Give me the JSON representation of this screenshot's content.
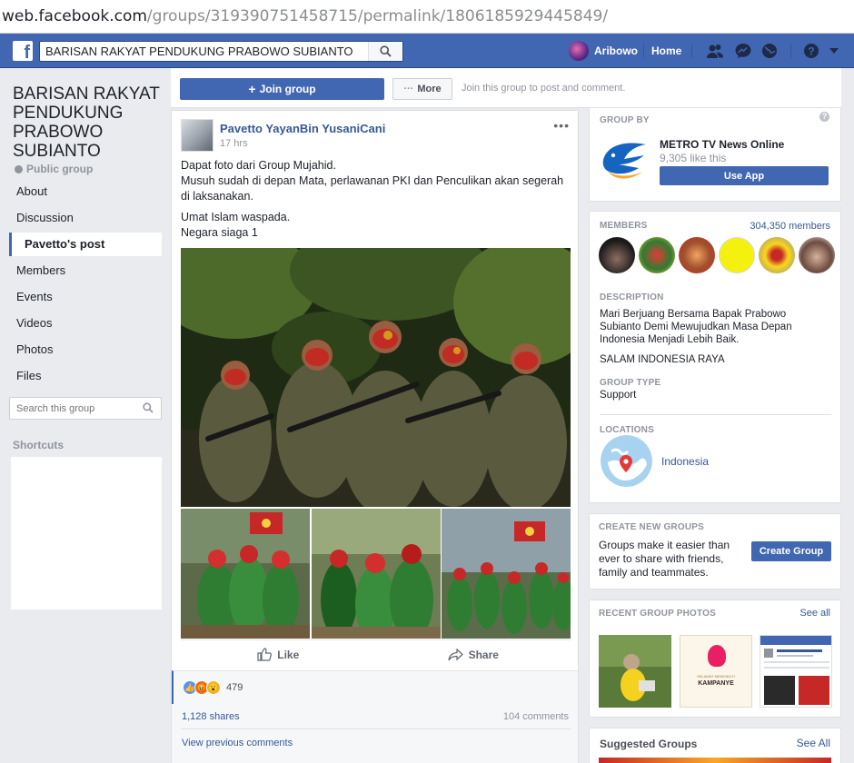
{
  "browser": {
    "url_host": "web.facebook.com",
    "url_path": "/groups/319390751458715/permalink/1806185929445849/"
  },
  "topbar": {
    "logo": "f",
    "search_value": "BARISAN RAKYAT PENDUKUNG PRABOWO SUBIANTO",
    "user_name": "Aribowo",
    "home_label": "Home",
    "icons": [
      "friends-icon",
      "messenger-icon",
      "globe-notifications-icon",
      "help-icon",
      "dropdown-caret-icon"
    ]
  },
  "sidebar": {
    "group_title": "BARISAN RAKYAT PENDUKUNG PRABOWO SUBIANTO",
    "privacy": "Public group",
    "items": [
      {
        "label": "About",
        "active": false
      },
      {
        "label": "Discussion",
        "active": false
      },
      {
        "label": "Pavetto's post",
        "active": true
      },
      {
        "label": "Members",
        "active": false
      },
      {
        "label": "Events",
        "active": false
      },
      {
        "label": "Videos",
        "active": false
      },
      {
        "label": "Photos",
        "active": false
      },
      {
        "label": "Files",
        "active": false
      }
    ],
    "search_placeholder": "Search this group",
    "shortcuts_label": "Shortcuts"
  },
  "actions": {
    "join_label": "Join group",
    "more_label": "More",
    "hint": "Join this group to post and comment."
  },
  "post": {
    "author": "Pavetto YayanBin YusaniCani",
    "time": "17 hrs",
    "para1_line1": "Dapat foto dari Group Mujahid.",
    "para1_line2": "Musuh sudah di depan Mata, perlawanan PKI dan Penculikan akan segerah di laksanakan.",
    "para2_line1": "Umat Islam waspada.",
    "para2_line2": "Negara siaga 1",
    "like_label": "Like",
    "share_label": "Share",
    "reaction_count": "479",
    "shares": "1,128 shares",
    "comments": "104 comments",
    "view_previous": "View previous comments"
  },
  "right": {
    "group_by": {
      "header": "GROUP BY",
      "page_name": "METRO TV News Online",
      "likes": "9,305 like this",
      "use_app": "Use App"
    },
    "members": {
      "header": "MEMBERS",
      "count": "304,350 members"
    },
    "description": {
      "header": "DESCRIPTION",
      "text": "Mari Berjuang Bersama Bapak Prabowo Subianto Demi Mewujudkan Masa Depan Indonesia Menjadi Lebih Baik.",
      "salam": "SALAM INDONESIA RAYA"
    },
    "group_type": {
      "header": "GROUP TYPE",
      "value": "Support"
    },
    "locations": {
      "header": "LOCATIONS",
      "value": "Indonesia"
    },
    "create": {
      "header": "CREATE NEW GROUPS",
      "text": "Groups make it easier than ever to share with friends, family and teammates.",
      "button": "Create Group"
    },
    "recent_photos": {
      "header": "RECENT GROUP PHOTOS",
      "see_all": "See all",
      "photo2_line1": "SELAMAT MENGIKUTI",
      "photo2_line2": "KAMPANYE"
    },
    "suggested": {
      "header": "Suggested Groups",
      "see_all": "See All"
    }
  },
  "colors": {
    "fb_blue": "#4267b2",
    "link": "#365899",
    "background": "#e9ebee"
  }
}
